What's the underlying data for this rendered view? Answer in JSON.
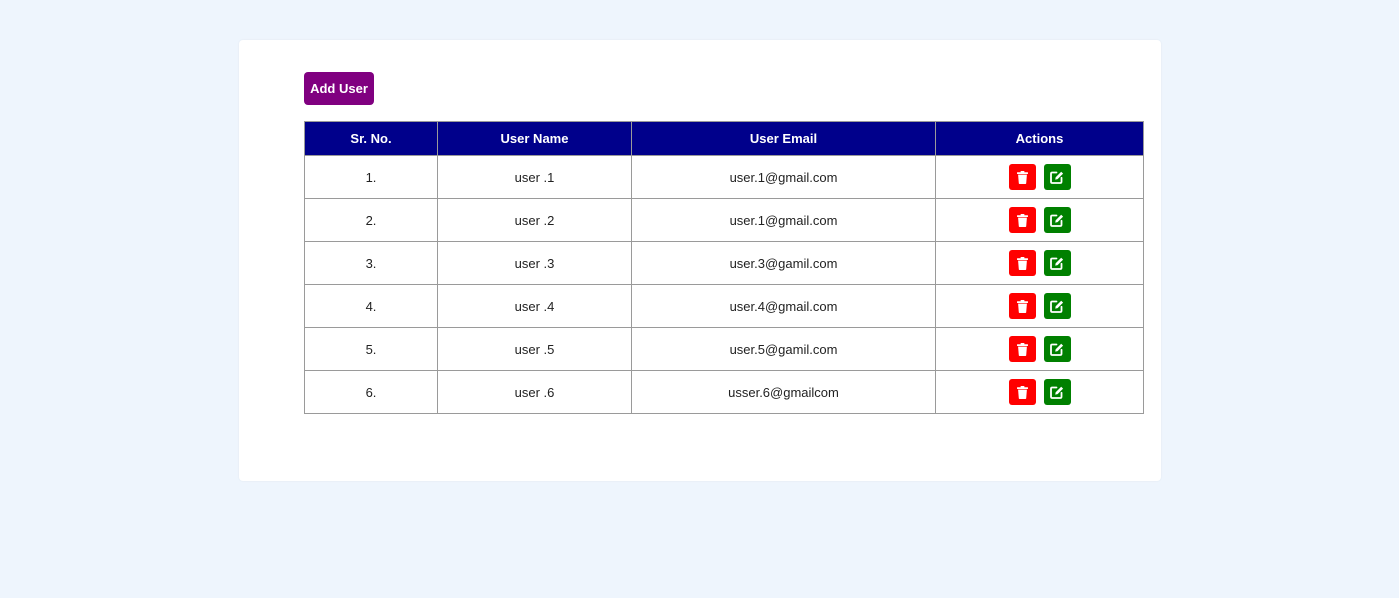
{
  "toolbar": {
    "add_user_label": "Add User"
  },
  "table": {
    "headers": [
      "Sr. No.",
      "User Name",
      "User Email",
      "Actions"
    ],
    "rows": [
      {
        "sr": "1.",
        "name": "user .1",
        "email": "user.1@gmail.com"
      },
      {
        "sr": "2.",
        "name": "user .2",
        "email": "user.1@gmail.com"
      },
      {
        "sr": "3.",
        "name": "user .3",
        "email": "user.3@gamil.com"
      },
      {
        "sr": "4.",
        "name": "user .4",
        "email": "user.4@gmail.com"
      },
      {
        "sr": "5.",
        "name": "user .5",
        "email": "user.5@gamil.com"
      },
      {
        "sr": "6.",
        "name": "user .6",
        "email": "usser.6@gmailcom"
      }
    ],
    "action_icons": {
      "delete": "trash-icon",
      "edit": "edit-icon"
    }
  },
  "colors": {
    "page_background": "#eef5fd",
    "add_button": "#800080",
    "header_background": "#00008b",
    "delete_button": "#ff0000",
    "edit_button": "#008000"
  }
}
